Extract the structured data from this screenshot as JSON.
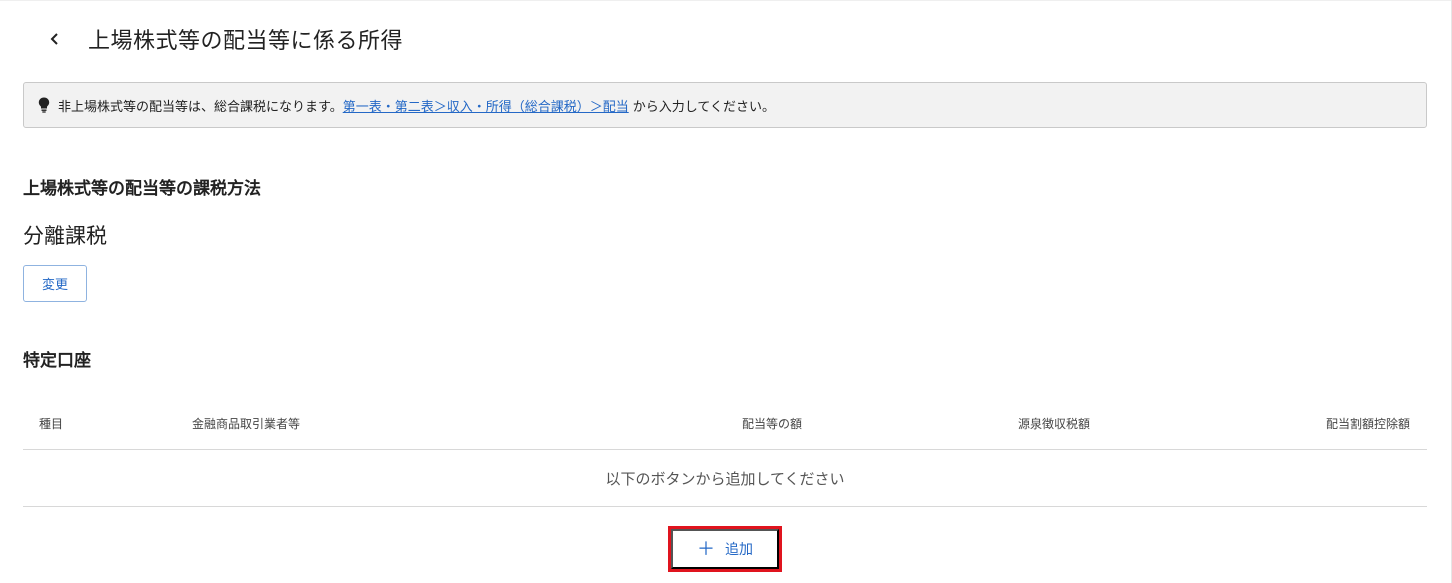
{
  "header": {
    "back_icon": "chevron-left-icon",
    "title": "上場株式等の配当等に係る所得"
  },
  "notice": {
    "icon": "lightbulb-icon",
    "text_before": "非上場株式等の配当等は、総合課税になります。",
    "link_text": "第一表・第二表＞収入・所得（総合課税）＞配当",
    "text_after": "から入力してください。"
  },
  "taxation": {
    "section_title": "上場株式等の配当等の課税方法",
    "value": "分離課税",
    "change_label": "変更"
  },
  "specific_account": {
    "section_title": "特定口座",
    "columns": [
      "種目",
      "金融商品取引業者等",
      "配当等の額",
      "源泉徴収税額",
      "配当割額控除額"
    ],
    "empty_message": "以下のボタンから追加してください",
    "add_icon": "plus-icon",
    "add_label": "追加"
  },
  "colors": {
    "link": "#2468c6",
    "highlight": "#e0141e",
    "notice_bg": "#f2f2f2"
  }
}
